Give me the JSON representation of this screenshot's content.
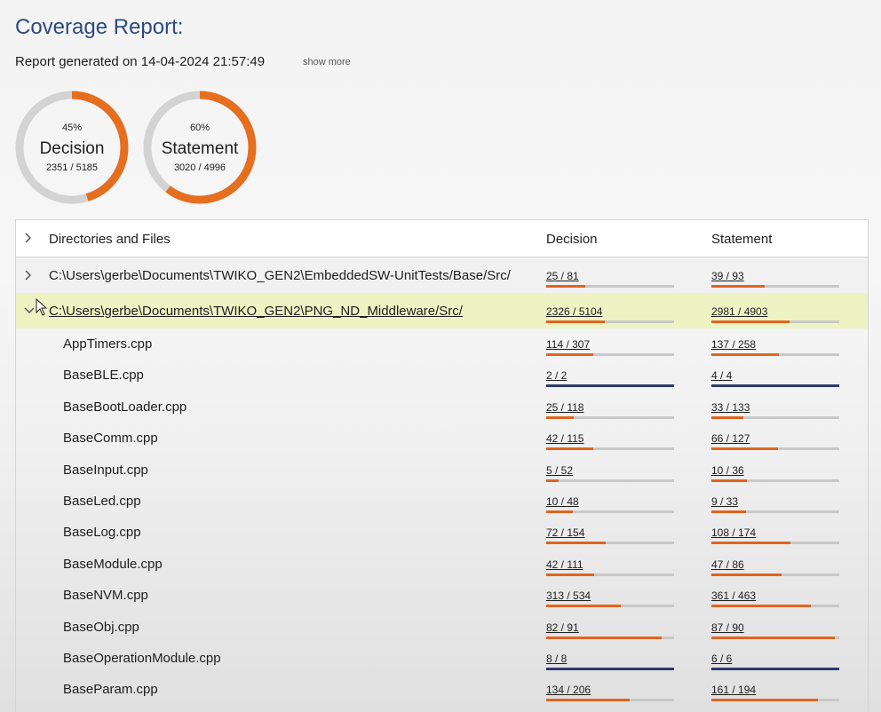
{
  "header": {
    "title": "Coverage Report:",
    "generated": "Report generated on 14-04-2024 21:57:49",
    "show_more": "show more"
  },
  "gauges": [
    {
      "pct": "45%",
      "name": "Decision",
      "ratio": "2351 / 5185",
      "fraction": 0.453,
      "color": "#e56e1f"
    },
    {
      "pct": "60%",
      "name": "Statement",
      "ratio": "3020 / 4996",
      "fraction": 0.604,
      "color": "#e56e1f"
    }
  ],
  "table": {
    "columns": [
      "Directories and Files",
      "Decision",
      "Statement"
    ],
    "directories": [
      {
        "path": "C:\\Users\\gerbe\\Documents\\TWIKO_GEN2\\EmbeddedSW-UnitTests/Base/Src/",
        "decision": "25 / 81",
        "decision_fraction": 0.309,
        "statement": "39 / 93",
        "statement_fraction": 0.419
      },
      {
        "path": "C:\\Users\\gerbe\\Documents\\TWIKO_GEN2\\PNG_ND_Middleware/Src/",
        "decision": "2326 / 5104",
        "decision_fraction": 0.456,
        "statement": "2981 / 4903",
        "statement_fraction": 0.608
      }
    ],
    "files": [
      {
        "name": "AppTimers.cpp",
        "decision": "114 / 307",
        "df": 0.371,
        "statement": "137 / 258",
        "sf": 0.531
      },
      {
        "name": "BaseBLE.cpp",
        "decision": "2 / 2",
        "df": 1.0,
        "statement": "4 / 4",
        "sf": 1.0
      },
      {
        "name": "BaseBootLoader.cpp",
        "decision": "25 / 118",
        "df": 0.212,
        "statement": "33 / 133",
        "sf": 0.248
      },
      {
        "name": "BaseComm.cpp",
        "decision": "42 / 115",
        "df": 0.365,
        "statement": "66 / 127",
        "sf": 0.52
      },
      {
        "name": "BaseInput.cpp",
        "decision": "5 / 52",
        "df": 0.096,
        "statement": "10 / 36",
        "sf": 0.278
      },
      {
        "name": "BaseLed.cpp",
        "decision": "10 / 48",
        "df": 0.208,
        "statement": "9 / 33",
        "sf": 0.273
      },
      {
        "name": "BaseLog.cpp",
        "decision": "72 / 154",
        "df": 0.468,
        "statement": "108 / 174",
        "sf": 0.621
      },
      {
        "name": "BaseModule.cpp",
        "decision": "42 / 111",
        "df": 0.378,
        "statement": "47 / 86",
        "sf": 0.547
      },
      {
        "name": "BaseNVM.cpp",
        "decision": "313 / 534",
        "df": 0.586,
        "statement": "361 / 463",
        "sf": 0.78
      },
      {
        "name": "BaseObj.cpp",
        "decision": "82 / 91",
        "df": 0.901,
        "statement": "87 / 90",
        "sf": 0.967
      },
      {
        "name": "BaseOperationModule.cpp",
        "decision": "8 / 8",
        "df": 1.0,
        "statement": "6 / 6",
        "sf": 1.0
      },
      {
        "name": "BaseParam.cpp",
        "decision": "134 / 206",
        "df": 0.65,
        "statement": "161 / 194",
        "sf": 0.83
      }
    ]
  },
  "colors": {
    "accent": "#e0641e",
    "complete": "#2b3a6e",
    "highlight_row": "#eef3c4",
    "title": "#2b4a7e"
  },
  "icons": [
    "chevron-right-icon",
    "chevron-down-icon",
    "mouse-cursor-icon"
  ]
}
